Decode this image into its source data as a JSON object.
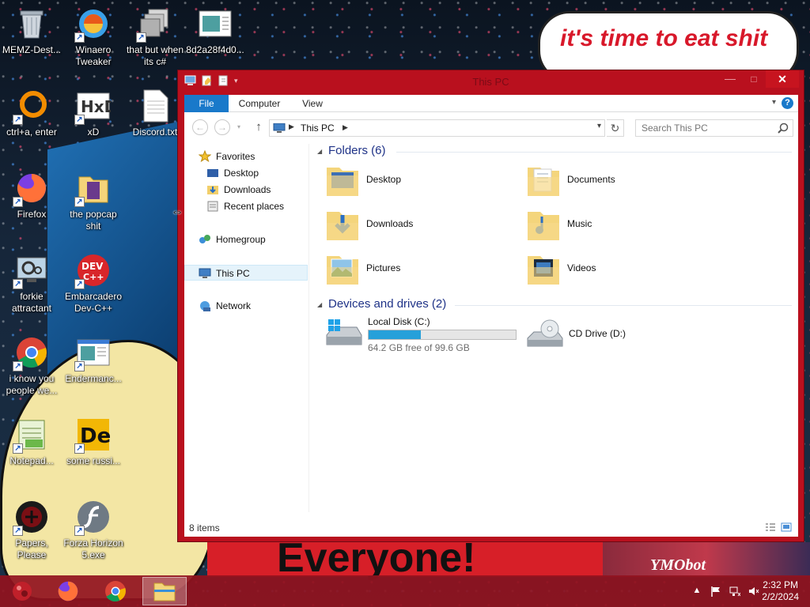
{
  "desktop": {
    "background_text": {
      "cloud": "it's time to eat shit",
      "banner": "Everyone!",
      "tag": "YMObot"
    },
    "icons": [
      {
        "label": "MEMZ-Dest...",
        "icon": "recycle-bin-icon"
      },
      {
        "label": "Winaero Tweaker",
        "icon": "winaero-icon"
      },
      {
        "label": "that but when its c#",
        "icon": "stack-icon"
      },
      {
        "label": "8d2a28f4d0...",
        "icon": "image-file-icon"
      },
      {
        "label": "ctrl+a, enter",
        "icon": "ring-icon"
      },
      {
        "label": "xD",
        "icon": "hxd-icon"
      },
      {
        "label": "Discord.txt",
        "icon": "text-file-icon"
      },
      {
        "label": "Firefox",
        "icon": "firefox-icon"
      },
      {
        "label": "the popcap shit",
        "icon": "popcap-folder-icon"
      },
      {
        "label": "forkie attractant",
        "icon": "gear-monitor-icon"
      },
      {
        "label": "Embarcadero Dev-C++",
        "icon": "devcpp-icon"
      },
      {
        "label": "i know you people we...",
        "icon": "chrome-icon"
      },
      {
        "label": "Endermanc...",
        "icon": "app-window-icon"
      },
      {
        "label": "Notepad...",
        "icon": "notepad-icon"
      },
      {
        "label": "some russi...",
        "icon": "de-icon"
      },
      {
        "label": "Papers, Please",
        "icon": "papers-please-icon"
      },
      {
        "label": "Forza Horizon 5.exe",
        "icon": "flash-icon"
      }
    ]
  },
  "window": {
    "title": "This PC",
    "controls": {
      "minimize": "—",
      "maximize": "□",
      "close": "✕"
    },
    "ribbon_tabs": [
      "File",
      "Computer",
      "View"
    ],
    "help": "?",
    "address": {
      "location": "This PC"
    },
    "search": {
      "placeholder": "Search This PC"
    },
    "nav": {
      "favorites": "Favorites",
      "desktop": "Desktop",
      "downloads": "Downloads",
      "recent": "Recent places",
      "homegroup": "Homegroup",
      "thispc": "This PC",
      "network": "Network"
    },
    "folders_header": "Folders (6)",
    "folders": [
      {
        "label": "Desktop",
        "icon": "desktop-folder-icon"
      },
      {
        "label": "Documents",
        "icon": "documents-folder-icon"
      },
      {
        "label": "Downloads",
        "icon": "downloads-folder-icon"
      },
      {
        "label": "Music",
        "icon": "music-folder-icon"
      },
      {
        "label": "Pictures",
        "icon": "pictures-folder-icon"
      },
      {
        "label": "Videos",
        "icon": "videos-folder-icon"
      }
    ],
    "devices_header": "Devices and drives (2)",
    "drives": [
      {
        "label": "Local Disk (C:)",
        "free": "64.2 GB free of 99.6 GB",
        "used_fraction": 0.355,
        "icon": "hard-disk-icon"
      },
      {
        "label": "CD Drive (D:)",
        "icon": "cd-drive-icon"
      }
    ],
    "status": "8 items"
  },
  "taskbar": {
    "time": "2:32 PM",
    "date": "2/2/2024",
    "colors": {
      "accent": "#b9101e",
      "file_tab": "#1979ca",
      "drive_bar": "#26a0da"
    }
  }
}
